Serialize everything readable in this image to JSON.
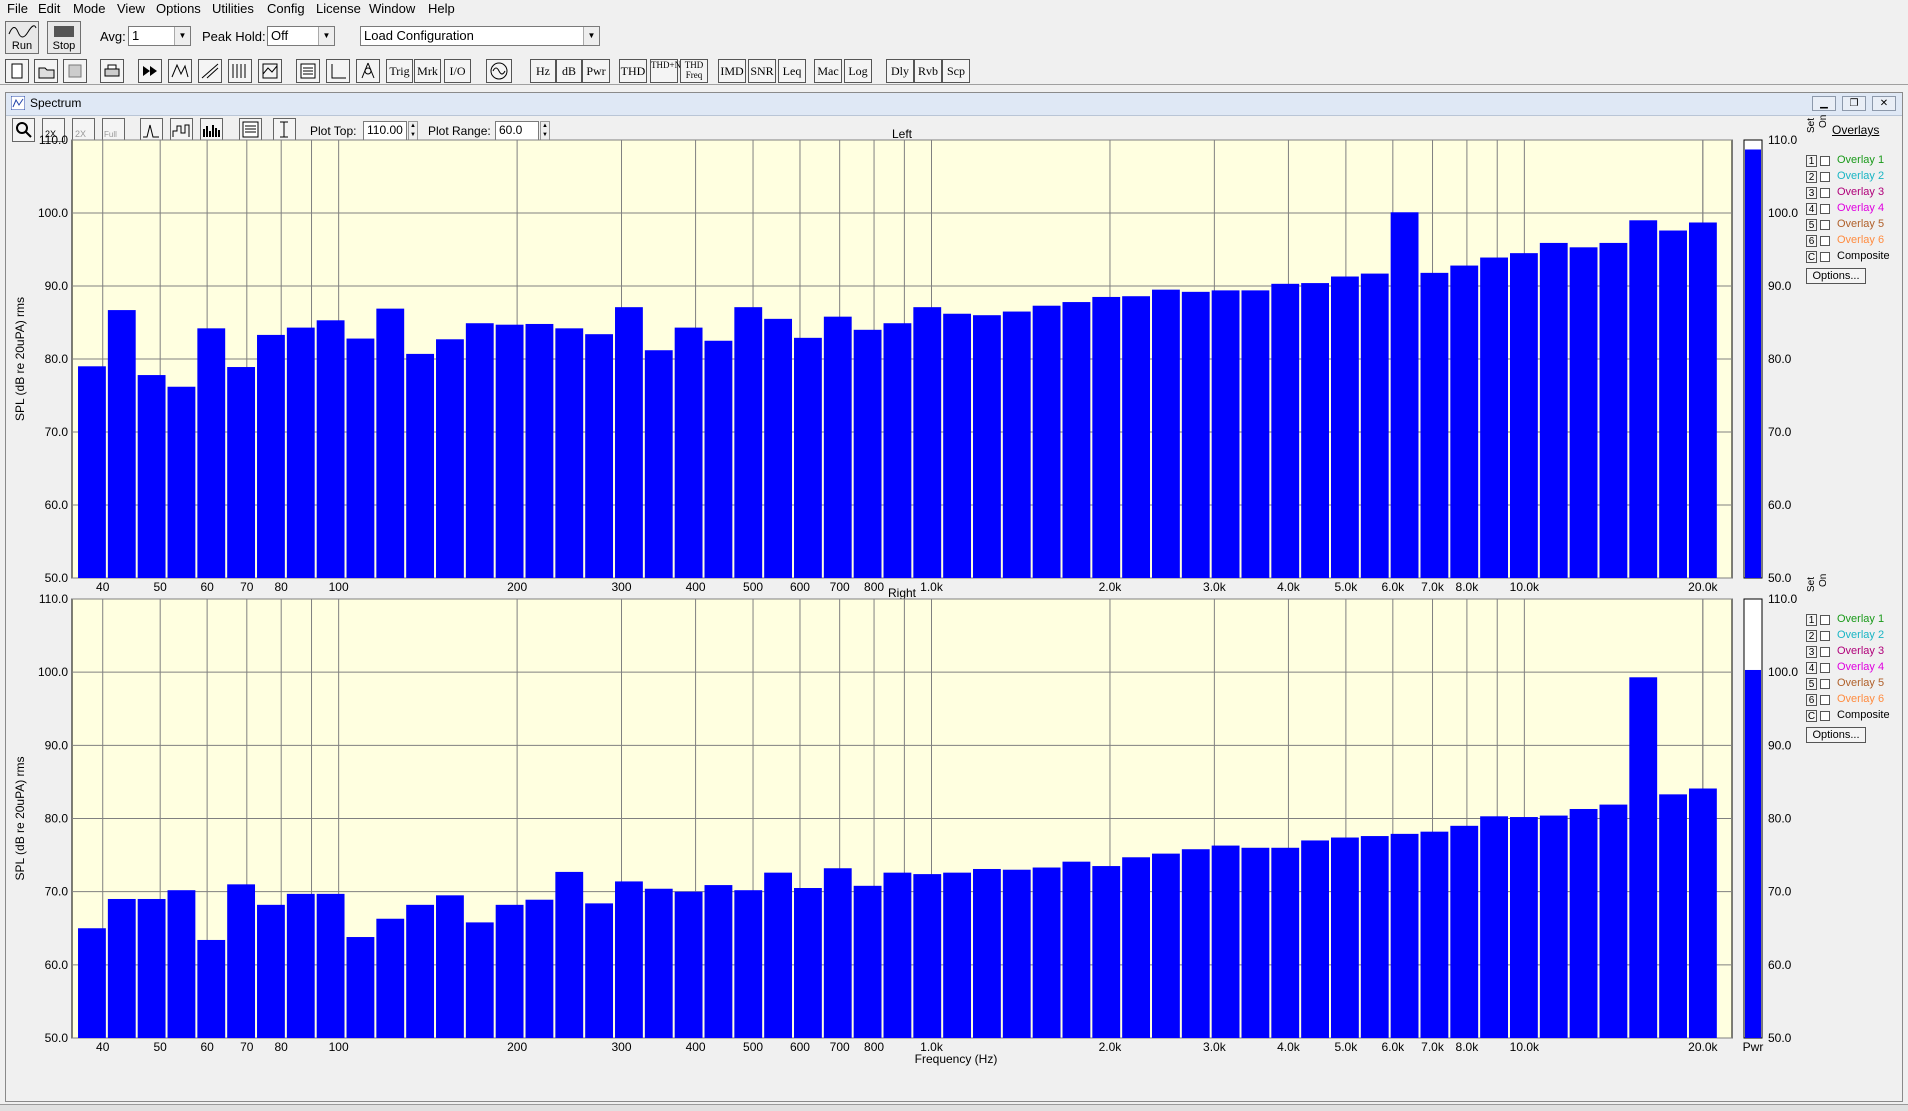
{
  "menu": [
    "File",
    "Edit",
    "Mode",
    "View",
    "Options",
    "Utilities",
    "Config",
    "License",
    "Window",
    "Help"
  ],
  "toolbar": {
    "run_label": "Run",
    "stop_label": "Stop",
    "avg_label": "Avg:",
    "avg_value": "1",
    "peak_hold_label": "Peak Hold:",
    "peak_hold_value": "Off",
    "config_value": "Load Configuration"
  },
  "tool_buttons": [
    "Trig",
    "Mrk",
    "I/O",
    "Hz",
    "dB",
    "Pwr",
    "THD",
    "THD+N",
    "THD Freq",
    "IMD",
    "SNR",
    "Leq",
    "Mac",
    "Log",
    "Dly",
    "Rvb",
    "Scp"
  ],
  "window": {
    "title": "Spectrum",
    "plot_top_label": "Plot Top:",
    "plot_top_value": "110.00",
    "plot_range_label": "Plot Range:",
    "plot_range_value": "60.0"
  },
  "overlays": {
    "heading": "Overlays",
    "set_label": "Set",
    "on_label": "On",
    "items": [
      {
        "num": "1",
        "label": "Overlay 1",
        "color": "#1a9a1a"
      },
      {
        "num": "2",
        "label": "Overlay 2",
        "color": "#19b5c4"
      },
      {
        "num": "3",
        "label": "Overlay 3",
        "color": "#b0007a"
      },
      {
        "num": "4",
        "label": "Overlay 4",
        "color": "#e000e0"
      },
      {
        "num": "5",
        "label": "Overlay 5",
        "color": "#b0602a"
      },
      {
        "num": "6",
        "label": "Overlay 6",
        "color": "#ff8c40"
      }
    ],
    "composite_num": "C",
    "composite_label": "Composite",
    "options_label": "Options..."
  },
  "colors": {
    "plot_bg": "#ffffe0",
    "bar": "#0000ff",
    "grid": "#808080"
  },
  "chart_data": [
    {
      "type": "bar",
      "title": "Left",
      "ylabel": "SPL (dB re 20uPA) rms",
      "xlabel": "Frequency (Hz)",
      "x_scale": "log",
      "ylim": [
        50,
        110
      ],
      "yticks": [
        "110.0",
        "100.0",
        "90.0",
        "80.0",
        "70.0",
        "60.0",
        "50.0"
      ],
      "xticks": [
        "40",
        "50",
        "60",
        "70",
        "80",
        "100",
        "200",
        "300",
        "400",
        "500",
        "600",
        "700",
        "800",
        "1.0k",
        "2.0k",
        "3.0k",
        "4.0k",
        "5.0k",
        "6.0k",
        "7.0k",
        "8.0k",
        "10.0k",
        "20.0k"
      ],
      "values": [
        79.0,
        86.7,
        77.8,
        76.2,
        84.2,
        78.9,
        83.3,
        84.3,
        85.3,
        82.8,
        86.9,
        80.7,
        82.7,
        84.9,
        84.7,
        84.8,
        84.2,
        83.4,
        87.1,
        81.2,
        84.3,
        82.5,
        87.1,
        85.5,
        82.9,
        85.8,
        84.0,
        84.9,
        87.1,
        86.2,
        86.0,
        86.5,
        87.3,
        87.8,
        88.5,
        88.6,
        89.5,
        89.2,
        89.4,
        89.4,
        90.3,
        90.4,
        91.3,
        91.7,
        100.1,
        91.8,
        92.8,
        93.9,
        94.5,
        95.9,
        95.3,
        95.9,
        99.0,
        97.6,
        98.7
      ],
      "pwr_label": "Pwr",
      "pwr_value": 108.7
    },
    {
      "type": "bar",
      "title": "Right",
      "ylabel": "SPL (dB re 20uPA) rms",
      "xlabel": "Frequency (Hz)",
      "x_scale": "log",
      "ylim": [
        50,
        110
      ],
      "yticks": [
        "110.0",
        "100.0",
        "90.0",
        "80.0",
        "70.0",
        "60.0",
        "50.0"
      ],
      "xticks": [
        "40",
        "50",
        "60",
        "70",
        "80",
        "100",
        "200",
        "300",
        "400",
        "500",
        "600",
        "700",
        "800",
        "1.0k",
        "2.0k",
        "3.0k",
        "4.0k",
        "5.0k",
        "6.0k",
        "7.0k",
        "8.0k",
        "10.0k",
        "20.0k"
      ],
      "values": [
        65.0,
        69.0,
        69.0,
        70.2,
        63.4,
        71.0,
        68.2,
        69.7,
        69.7,
        63.8,
        66.3,
        68.2,
        69.5,
        65.8,
        68.2,
        68.9,
        72.7,
        68.4,
        71.4,
        70.4,
        70.0,
        70.9,
        70.2,
        72.6,
        70.5,
        73.2,
        70.8,
        72.6,
        72.4,
        72.6,
        73.1,
        73.0,
        73.3,
        74.1,
        73.5,
        74.7,
        75.2,
        75.8,
        76.3,
        76.0,
        76.0,
        77.0,
        77.4,
        77.6,
        77.9,
        78.2,
        79.0,
        80.3,
        80.2,
        80.4,
        81.3,
        81.9,
        99.3,
        83.3,
        84.1
      ],
      "pwr_label": "Pwr",
      "pwr_value": 100.3
    }
  ]
}
